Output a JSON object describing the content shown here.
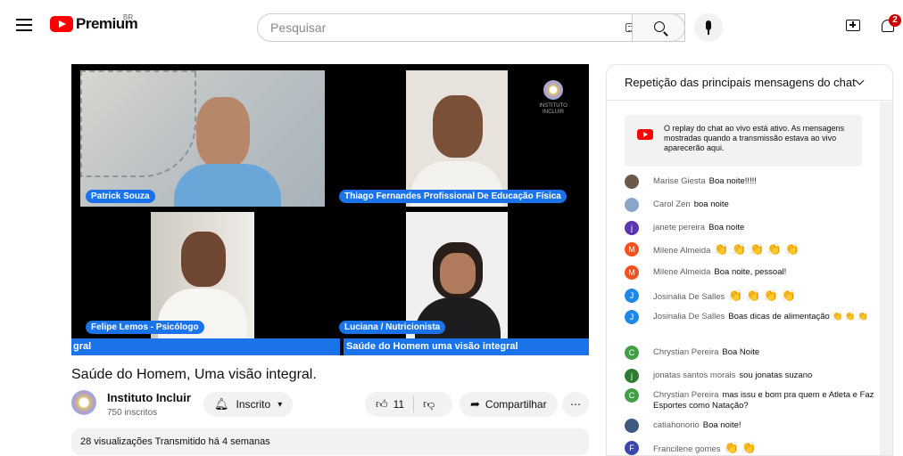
{
  "header": {
    "logo_text": "Premium",
    "country": "BR",
    "search_placeholder": "Pesquisar",
    "notifications": "2"
  },
  "video": {
    "participants": [
      "Patrick Souza",
      "Thiago Fernandes Profissional De Educação Física",
      "Felipe Lemos - Psicólogo",
      "Luciana / Nutricionista"
    ],
    "banner_left": "gral",
    "banner_main": "Saúde do Homem uma visão integral",
    "watermark": "INSTITUTO INCLUIR"
  },
  "meta": {
    "title": "Saúde do Homem, Uma visão integral.",
    "channel": "Instituto Incluir",
    "subscribers": "750 inscritos",
    "subscribe_label": "Inscrito",
    "likes": "11",
    "share_label": "Compartilhar",
    "description": "28 visualizações  Transmitido há 4 semanas"
  },
  "chat": {
    "header": "Repetição das principais mensagens do chat",
    "notice": "O replay do chat ao vivo está ativo. As mensagens mostradas quando a transmissão estava ao vivo aparecerão aqui.",
    "messages": [
      {
        "author": "Marise Giesta",
        "text": "Boa noite!!!!!",
        "initial": "",
        "color": "#6b5a4a"
      },
      {
        "author": "Carol Zen",
        "text": "boa noite",
        "initial": "",
        "color": "#8aa7c9"
      },
      {
        "author": "janete pereira",
        "text": "Boa noite",
        "initial": "j",
        "color": "#5e35b1"
      },
      {
        "author": "Milene Almeida",
        "text": "👏 👏 👏 👏 👏",
        "initial": "M",
        "color": "#f4511e"
      },
      {
        "author": "Milene Almeida",
        "text": "Boa noite, pessoal!",
        "initial": "M",
        "color": "#f4511e"
      },
      {
        "author": "Josinalia De Salles",
        "text": "👏 👏 👏 👏",
        "initial": "J",
        "color": "#1e88e5"
      },
      {
        "author": "Josinalia De Salles",
        "text": "Boas dicas de alimentação 👏 👏 👏",
        "initial": "J",
        "color": "#1e88e5"
      },
      {
        "author": "Chrystian Pereira",
        "text": "Boa Noite",
        "initial": "C",
        "color": "#43a047"
      },
      {
        "author": "jonatas santos morais",
        "text": "sou jonatas suzano",
        "initial": "j",
        "color": "#2e7d32"
      },
      {
        "author": "Chrystian Pereira",
        "text": "mas issu e bom pra quem e Atleta e Faz Esportes como Natação?",
        "initial": "C",
        "color": "#43a047"
      },
      {
        "author": "catiahonorio",
        "text": "Boa noite!",
        "initial": "",
        "color": "#3d5a80"
      },
      {
        "author": "Francilene gomes",
        "text": "👏 👏",
        "initial": "F",
        "color": "#3949ab"
      }
    ]
  }
}
